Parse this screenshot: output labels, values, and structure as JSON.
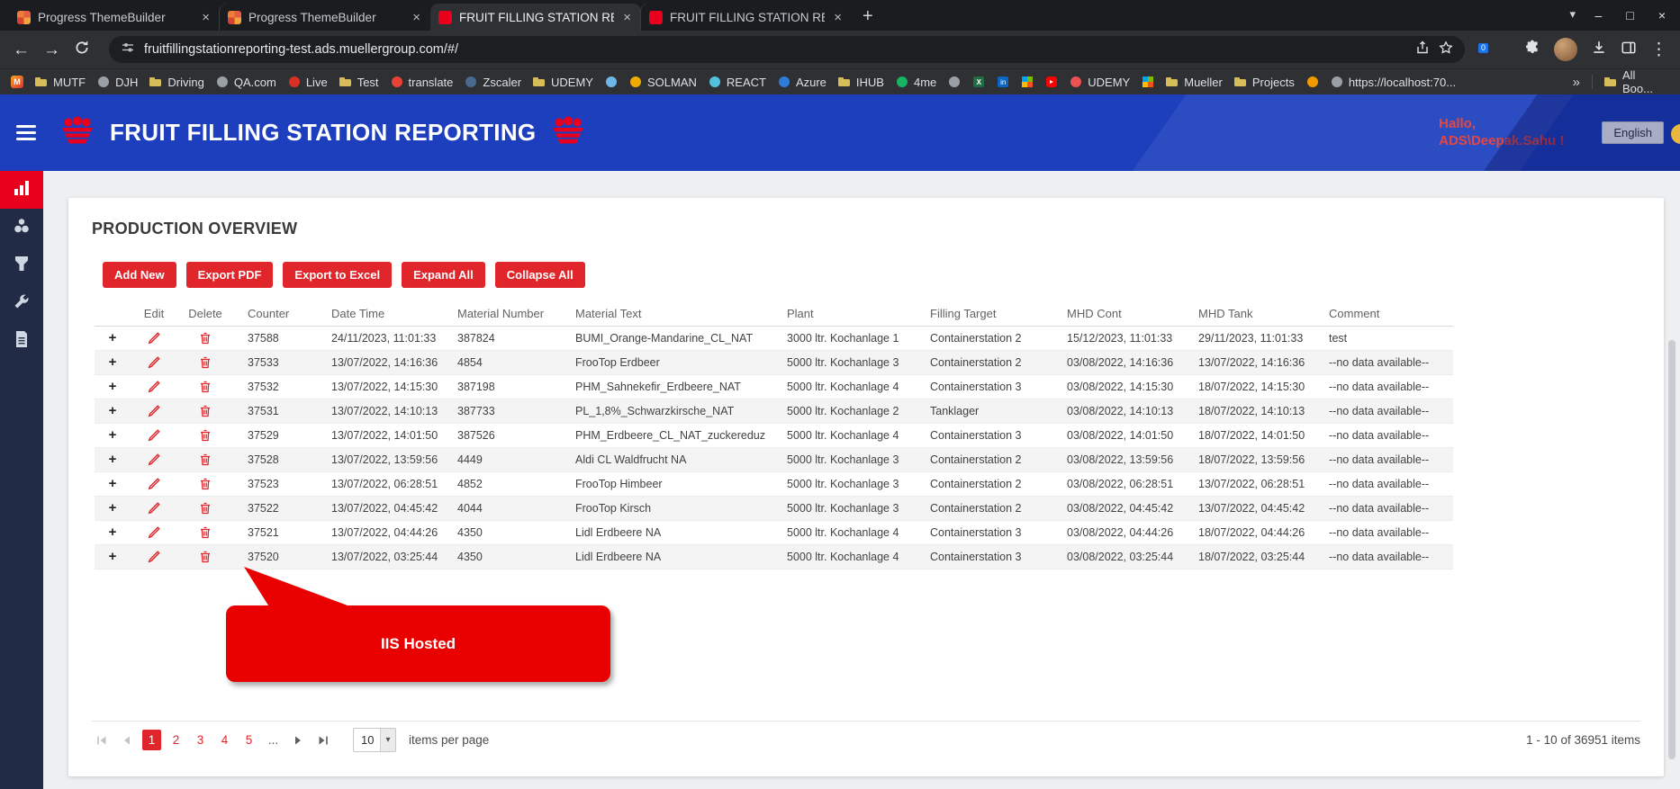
{
  "glyphs": {
    "plus": "+",
    "close": "×",
    "minimize": "–",
    "maximize": "□",
    "menu_kebab": "⋮",
    "chevron_down": "▾",
    "back": "←",
    "forward": "→",
    "overflow": "»"
  },
  "colors": {
    "accent_red": "#e0252b",
    "callout_red": "#e90000",
    "header_blue": "#1d3fbe",
    "sidebar_active_red": "#e8001c"
  },
  "browser": {
    "tabs": [
      {
        "title": "Progress ThemeBuilder",
        "favicon": "themebuilder",
        "active": false
      },
      {
        "title": "Progress ThemeBuilder",
        "favicon": "themebuilder",
        "active": false
      },
      {
        "title": "FRUIT FILLING STATION REPORT",
        "favicon": "fruit",
        "active": true
      },
      {
        "title": "FRUIT FILLING STATION REPORT",
        "favicon": "fruit",
        "active": false
      }
    ],
    "url": "fruitfillingstationreporting-test.ads.muellergroup.com/#/",
    "extension_badge": "0",
    "all_bookmarks_label": "All Boo...",
    "bookmarks": [
      {
        "label": "",
        "icon": "m-logo"
      },
      {
        "label": "MUTF",
        "icon": "folder"
      },
      {
        "label": "DJH",
        "icon": "globe"
      },
      {
        "label": "Driving",
        "icon": "folder"
      },
      {
        "label": "QA.com",
        "icon": "globe"
      },
      {
        "label": "Live",
        "icon": "dot",
        "color": "#d93025"
      },
      {
        "label": "Test",
        "icon": "folder"
      },
      {
        "label": "translate",
        "icon": "dot",
        "color": "#ea4335"
      },
      {
        "label": "Zscaler",
        "icon": "dot",
        "color": "#486a8e"
      },
      {
        "label": "UDEMY",
        "icon": "folder"
      },
      {
        "label": "",
        "icon": "dot",
        "color": "#6fb6e8"
      },
      {
        "label": "SOLMAN",
        "icon": "dot",
        "color": "#f0ab00"
      },
      {
        "label": "REACT",
        "icon": "dot",
        "color": "#53c1de"
      },
      {
        "label": "Azure",
        "icon": "dot",
        "color": "#2f7cd6"
      },
      {
        "label": "IHUB",
        "icon": "folder"
      },
      {
        "label": "4me",
        "icon": "dot",
        "color": "#18b263"
      },
      {
        "label": "",
        "icon": "dot",
        "color": "#9aa0a6"
      },
      {
        "label": "",
        "icon": "excel"
      },
      {
        "label": "",
        "icon": "linkedin"
      },
      {
        "label": "",
        "icon": "grid"
      },
      {
        "label": "",
        "icon": "youtube"
      },
      {
        "label": "UDEMY",
        "icon": "dot",
        "color": "#ec5252"
      },
      {
        "label": "",
        "icon": "grid"
      },
      {
        "label": "Mueller",
        "icon": "folder"
      },
      {
        "label": "Projects",
        "icon": "folder"
      },
      {
        "label": "",
        "icon": "dot",
        "color": "#f29900"
      },
      {
        "label": "https://localhost:70...",
        "icon": "globe"
      }
    ]
  },
  "app_header": {
    "title": "FRUIT FILLING STATION REPORTING",
    "greeting_line1": "Hallo,",
    "greeting_line2": "ADS\\Deepak.Sahu !",
    "language": "English"
  },
  "sidebar": {
    "items": [
      {
        "icon": "bar-chart",
        "active": true
      },
      {
        "icon": "fruit",
        "active": false
      },
      {
        "icon": "filling-station",
        "active": false
      },
      {
        "icon": "wrench",
        "active": false
      },
      {
        "icon": "report",
        "active": false
      }
    ]
  },
  "main": {
    "title": "PRODUCTION OVERVIEW",
    "toolbar": {
      "add_new": "Add New",
      "export_pdf": "Export PDF",
      "export_excel": "Export to Excel",
      "expand_all": "Expand All",
      "collapse_all": "Collapse All"
    },
    "table": {
      "headers": [
        "",
        "Edit",
        "Delete",
        "Counter",
        "Date Time",
        "Material Number",
        "Material Text",
        "Plant",
        "Filling Target",
        "MHD Cont",
        "MHD Tank",
        "Comment"
      ],
      "rows": [
        {
          "counter": "37588",
          "date_time": "24/11/2023, 11:01:33",
          "material_number": "387824",
          "material_text": "BUMI_Orange-Mandarine_CL_NAT",
          "plant": "3000 ltr. Kochanlage 1",
          "filling_target": "Containerstation 2",
          "mhd_cont": "15/12/2023, 11:01:33",
          "mhd_tank": "29/11/2023, 11:01:33",
          "comment": "test"
        },
        {
          "counter": "37533",
          "date_time": "13/07/2022, 14:16:36",
          "material_number": "4854",
          "material_text": "FrooTop Erdbeer",
          "plant": "5000 ltr. Kochanlage 3",
          "filling_target": "Containerstation 2",
          "mhd_cont": "03/08/2022, 14:16:36",
          "mhd_tank": "13/07/2022, 14:16:36",
          "comment": "--no data available--"
        },
        {
          "counter": "37532",
          "date_time": "13/07/2022, 14:15:30",
          "material_number": "387198",
          "material_text": "PHM_Sahnekefir_Erdbeere_NAT",
          "plant": "5000 ltr. Kochanlage 4",
          "filling_target": "Containerstation 3",
          "mhd_cont": "03/08/2022, 14:15:30",
          "mhd_tank": "18/07/2022, 14:15:30",
          "comment": "--no data available--"
        },
        {
          "counter": "37531",
          "date_time": "13/07/2022, 14:10:13",
          "material_number": "387733",
          "material_text": "PL_1,8%_Schwarzkirsche_NAT",
          "plant": "5000 ltr. Kochanlage 2",
          "filling_target": "Tanklager",
          "mhd_cont": "03/08/2022, 14:10:13",
          "mhd_tank": "18/07/2022, 14:10:13",
          "comment": "--no data available--"
        },
        {
          "counter": "37529",
          "date_time": "13/07/2022, 14:01:50",
          "material_number": "387526",
          "material_text": "PHM_Erdbeere_CL_NAT_zuckereduz",
          "plant": "5000 ltr. Kochanlage 4",
          "filling_target": "Containerstation 3",
          "mhd_cont": "03/08/2022, 14:01:50",
          "mhd_tank": "18/07/2022, 14:01:50",
          "comment": "--no data available--"
        },
        {
          "counter": "37528",
          "date_time": "13/07/2022, 13:59:56",
          "material_number": "4449",
          "material_text": "Aldi CL Waldfrucht NA",
          "plant": "5000 ltr. Kochanlage 3",
          "filling_target": "Containerstation 2",
          "mhd_cont": "03/08/2022, 13:59:56",
          "mhd_tank": "18/07/2022, 13:59:56",
          "comment": "--no data available--"
        },
        {
          "counter": "37523",
          "date_time": "13/07/2022, 06:28:51",
          "material_number": "4852",
          "material_text": "FrooTop Himbeer",
          "plant": "5000 ltr. Kochanlage 3",
          "filling_target": "Containerstation 2",
          "mhd_cont": "03/08/2022, 06:28:51",
          "mhd_tank": "13/07/2022, 06:28:51",
          "comment": "--no data available--"
        },
        {
          "counter": "37522",
          "date_time": "13/07/2022, 04:45:42",
          "material_number": "4044",
          "material_text": "FrooTop Kirsch",
          "plant": "5000 ltr. Kochanlage 3",
          "filling_target": "Containerstation 2",
          "mhd_cont": "03/08/2022, 04:45:42",
          "mhd_tank": "13/07/2022, 04:45:42",
          "comment": "--no data available--"
        },
        {
          "counter": "37521",
          "date_time": "13/07/2022, 04:44:26",
          "material_number": "4350",
          "material_text": "Lidl Erdbeere NA",
          "plant": "5000 ltr. Kochanlage 4",
          "filling_target": "Containerstation 3",
          "mhd_cont": "03/08/2022, 04:44:26",
          "mhd_tank": "18/07/2022, 04:44:26",
          "comment": "--no data available--"
        },
        {
          "counter": "37520",
          "date_time": "13/07/2022, 03:25:44",
          "material_number": "4350",
          "material_text": "Lidl Erdbeere NA",
          "plant": "5000 ltr. Kochanlage 4",
          "filling_target": "Containerstation 3",
          "mhd_cont": "03/08/2022, 03:25:44",
          "mhd_tank": "18/07/2022, 03:25:44",
          "comment": "--no data available--"
        }
      ]
    },
    "callout": {
      "text": "IIS Hosted"
    },
    "pagination": {
      "pages": [
        {
          "label": "1",
          "active": true
        },
        {
          "label": "2"
        },
        {
          "label": "3"
        },
        {
          "label": "4"
        },
        {
          "label": "5"
        },
        {
          "label": "...",
          "ellipsis": true
        }
      ],
      "page_size": "10",
      "items_per_page": "items per page",
      "summary": "1 - 10 of 36951 items"
    }
  }
}
